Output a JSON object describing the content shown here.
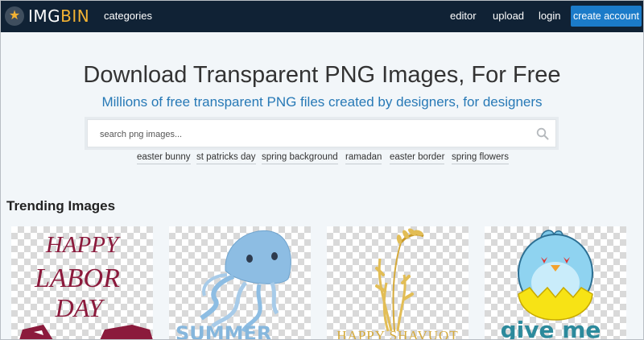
{
  "brand": {
    "part1": "IMG",
    "part2": "BIN"
  },
  "nav": {
    "categories": "categories",
    "editor": "editor",
    "upload": "upload",
    "login": "login",
    "create_account": "create account"
  },
  "hero": {
    "title": "Download Transparent PNG Images, For Free",
    "subtitle": "Millions of free transparent PNG files created by designers, for designers"
  },
  "search": {
    "placeholder": "search png images..."
  },
  "tags": [
    "easter bunny",
    "st patricks day",
    "spring background",
    "ramadan",
    "easter border",
    "spring flowers"
  ],
  "trending": {
    "title": "Trending Images",
    "cards": [
      {
        "lines": [
          "HAPPY",
          "LABOR",
          "DAY"
        ],
        "color": "#8b1a3c"
      },
      {
        "text": "SUMMER",
        "color": "#86b7dd"
      },
      {
        "text": "HAPPY SHAVUOT",
        "color": "#d4a93a"
      },
      {
        "text": "give me",
        "color": "#2c8a9c"
      }
    ]
  },
  "colors": {
    "nav_bg": "#102235",
    "accent": "#1b7bc9",
    "brand_yellow": "#f2b233",
    "subtitle": "#2779b6"
  }
}
